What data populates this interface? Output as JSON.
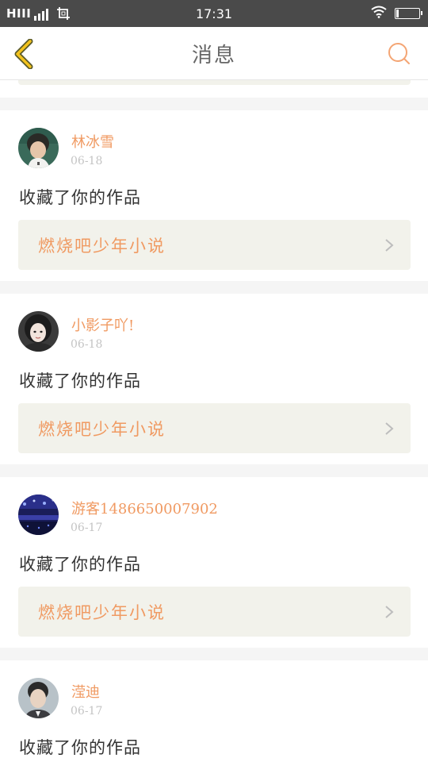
{
  "status_bar": {
    "carrier": "HIII",
    "time": "17:31",
    "battery_level_fraction": 0.1
  },
  "header": {
    "title": "消息",
    "back_icon": "chevron-left-icon",
    "search_icon": "search-icon"
  },
  "accent_color": "#f09a62",
  "messages": [
    {
      "username": "林冰雪",
      "date": "06-18",
      "action": "收藏了你的作品",
      "work_title": "燃烧吧少年小说",
      "avatar": "boy-photo"
    },
    {
      "username": "小影子吖!",
      "date": "06-18",
      "action": "收藏了你的作品",
      "work_title": "燃烧吧少年小说",
      "avatar": "girl-photo"
    },
    {
      "username": "游客1486650007902",
      "date": "06-17",
      "action": "收藏了你的作品",
      "work_title": "燃烧吧少年小说",
      "avatar": "stage-lights-photo"
    },
    {
      "username": "滢迪",
      "date": "06-17",
      "action": "收藏了你的作品",
      "avatar": "man-portrait-photo"
    }
  ]
}
